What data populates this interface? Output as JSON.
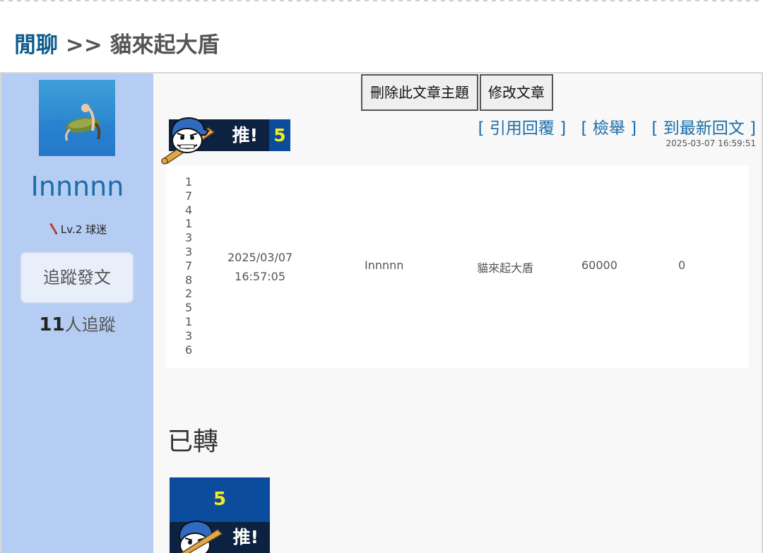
{
  "breadcrumb": {
    "forum": "閒聊",
    "separator": ">>",
    "topic": "貓來起大盾"
  },
  "sidebar": {
    "username": "Innnnn",
    "level": "Lv.2 球迷",
    "follow_button": "追蹤發文",
    "follower_count": "11",
    "follower_suffix": "人追蹤"
  },
  "toolbar": {
    "delete_label": "刪除此文章主題",
    "edit_label": "修改文章"
  },
  "push": {
    "label": "推!",
    "count": "5"
  },
  "links": {
    "quote_reply": "[ 引用回覆 ]",
    "report": "[ 檢舉 ]",
    "latest_reply": "[ 到最新回文 ]"
  },
  "post_timestamp": "2025-03-07 16:59:51",
  "info_row": {
    "digits": [
      "1",
      "7",
      "4",
      "1",
      "3",
      "3",
      "7",
      "8",
      "2",
      "5",
      "1",
      "3",
      "6"
    ],
    "date": "2025/03/07",
    "time": "16:57:05",
    "author": "Innnnn",
    "title": "貓來起大盾",
    "amount": "60000",
    "zero": "0"
  },
  "post_body": "已轉",
  "push_big": {
    "count": "5",
    "label": "推!"
  },
  "colors": {
    "sidebar_bg": "#b6cdf3",
    "link": "#1b6da8",
    "push_navy": "#0d2240",
    "push_blue": "#0c4c9c",
    "push_yellow": "#f3ec1e"
  }
}
